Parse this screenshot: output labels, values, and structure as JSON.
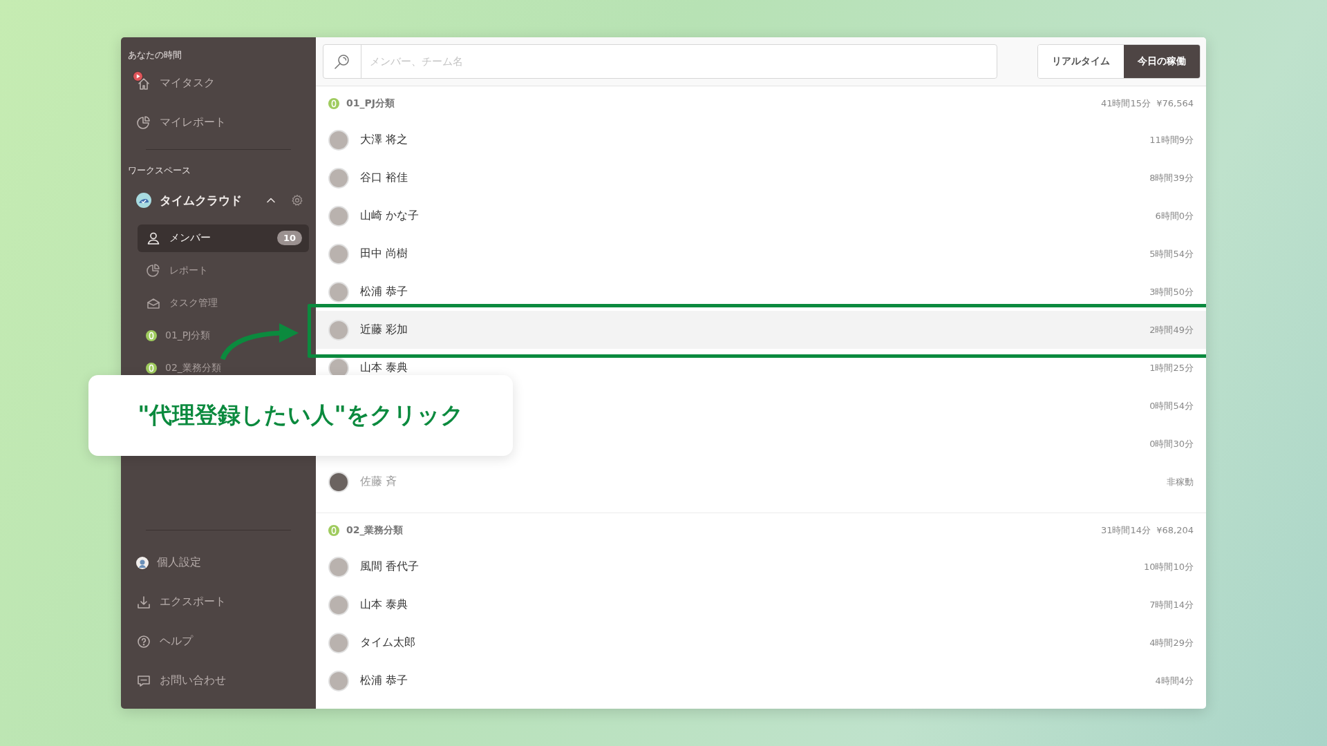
{
  "sidebar": {
    "personal": {
      "heading": "あなたの時間",
      "items": [
        {
          "label": "マイタスク",
          "kind": "home",
          "timer_running": true
        },
        {
          "label": "マイレポート",
          "kind": "report",
          "timer_running": false
        }
      ]
    },
    "workspace": {
      "heading": "ワークスペース",
      "name": "タイムクラウド",
      "expanded": true,
      "items": [
        {
          "label": "メンバー",
          "kind": "member",
          "selected": true,
          "badge": "10"
        },
        {
          "label": "レポート",
          "kind": "report",
          "selected": false
        },
        {
          "label": "タスク管理",
          "kind": "tray",
          "selected": false
        },
        {
          "label": "01_PJ分類",
          "kind": "category",
          "selected": false
        },
        {
          "label": "02_業務分類",
          "kind": "category",
          "selected": false
        }
      ]
    },
    "footer": [
      {
        "label": "個人設定",
        "kind": "avatar"
      },
      {
        "label": "エクスポート",
        "kind": "download"
      },
      {
        "label": "ヘルプ",
        "kind": "help"
      },
      {
        "label": "お問い合わせ",
        "kind": "chat"
      }
    ]
  },
  "search": {
    "placeholder": "メンバー、チーム名"
  },
  "view_toggle": [
    {
      "label": "リアルタイム",
      "selected": false
    },
    {
      "label": "今日の稼働",
      "selected": true
    }
  ],
  "groups": [
    {
      "name": "01_PJ分類",
      "total": "41時間15分",
      "amount": "¥76,564",
      "members": [
        {
          "name": "大澤 将之",
          "time": "11時間9分",
          "active": true,
          "highlighted": false
        },
        {
          "name": "谷口 裕佳",
          "time": "8時間39分",
          "active": true,
          "highlighted": false
        },
        {
          "name": "山崎 かな子",
          "time": "6時間0分",
          "active": true,
          "highlighted": false
        },
        {
          "name": "田中 尚樹",
          "time": "5時間54分",
          "active": true,
          "highlighted": false
        },
        {
          "name": "松浦 恭子",
          "time": "3時間50分",
          "active": true,
          "highlighted": false
        },
        {
          "name": "近藤 彩加",
          "time": "2時間49分",
          "active": true,
          "highlighted": true
        },
        {
          "name": "山本 泰典",
          "time": "1時間25分",
          "active": true,
          "highlighted": false
        },
        {
          "time": "0時間54分"
        },
        {
          "time": "0時間30分"
        },
        {
          "name": "佐藤 斉",
          "time": "非稼動",
          "active": false,
          "highlighted": false
        }
      ]
    },
    {
      "name": "02_業務分類",
      "total": "31時間14分",
      "amount": "¥68,204",
      "members": [
        {
          "name": "風間 香代子",
          "time": "10時間10分",
          "active": true,
          "highlighted": false
        },
        {
          "name": "山本 泰典",
          "time": "7時間14分",
          "active": true,
          "highlighted": false
        },
        {
          "name": "タイム太郎",
          "time": "4時間29分",
          "active": true,
          "highlighted": false
        },
        {
          "name": "松浦 恭子",
          "time": "4時間4分",
          "active": true,
          "highlighted": false
        }
      ]
    }
  ],
  "callout": {
    "text": "\"代理登録したい人\"をクリック"
  }
}
